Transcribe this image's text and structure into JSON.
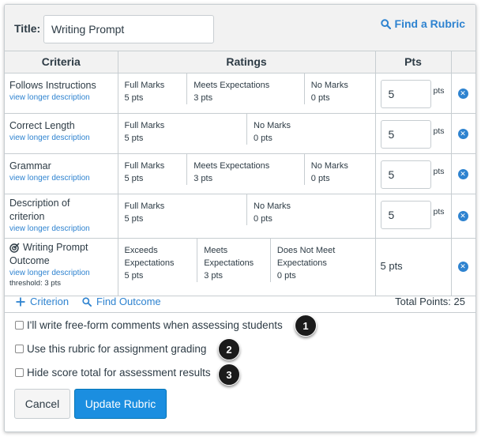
{
  "title_label": "Title:",
  "title_value": "Writing Prompt",
  "find_rubric_label": "Find a Rubric",
  "headers": {
    "criteria": "Criteria",
    "ratings": "Ratings",
    "pts": "Pts"
  },
  "view_longer": "view longer description",
  "pts_suffix": "pts",
  "criteria": [
    {
      "name": "Follows Instructions",
      "points": "5",
      "ratings": [
        {
          "label": "Full Marks",
          "pts": "5 pts"
        },
        {
          "label": "Meets Expectations",
          "pts": "3 pts"
        },
        {
          "label": "No Marks",
          "pts": "0 pts"
        }
      ]
    },
    {
      "name": "Correct Length",
      "points": "5",
      "ratings": [
        {
          "label": "Full Marks",
          "pts": "5 pts"
        },
        {
          "label": "No Marks",
          "pts": "0 pts"
        }
      ]
    },
    {
      "name": "Grammar",
      "points": "5",
      "ratings": [
        {
          "label": "Full Marks",
          "pts": "5 pts"
        },
        {
          "label": "Meets Expectations",
          "pts": "3 pts"
        },
        {
          "label": "No Marks",
          "pts": "0 pts"
        }
      ]
    },
    {
      "name_line1": "Description of",
      "name_line2": "criterion",
      "points": "5",
      "ratings": [
        {
          "label": "Full Marks",
          "pts": "5 pts"
        },
        {
          "label": "No Marks",
          "pts": "0 pts"
        }
      ]
    },
    {
      "name_line1": "Writing Prompt",
      "name_line2": "Outcome",
      "threshold": "threshold: 3 pts",
      "points_text": "5 pts",
      "ratings": [
        {
          "label1": "Exceeds",
          "label2": "Expectations",
          "pts": "5 pts"
        },
        {
          "label1": "Meets",
          "label2": "Expectations",
          "pts": "3 pts"
        },
        {
          "label1": "Does Not Meet",
          "label2": "Expectations",
          "pts": "0 pts"
        }
      ]
    }
  ],
  "add_criterion": "Criterion",
  "find_outcome": "Find Outcome",
  "total_points": "Total Points: 25",
  "options": [
    {
      "label": "I'll write free-form comments when assessing students",
      "badge": "1"
    },
    {
      "label": "Use this rubric for assignment grading",
      "badge": "2"
    },
    {
      "label": "Hide score total for assessment results",
      "badge": "3"
    }
  ],
  "cancel_label": "Cancel",
  "update_label": "Update Rubric",
  "icons": {
    "search": "search-icon",
    "plus": "plus-icon",
    "target": "target-icon",
    "delete": "close-circle-icon"
  },
  "colors": {
    "link": "#2e83d0",
    "primary": "#1b8ee0",
    "header_bg": "#f2f2f2"
  }
}
